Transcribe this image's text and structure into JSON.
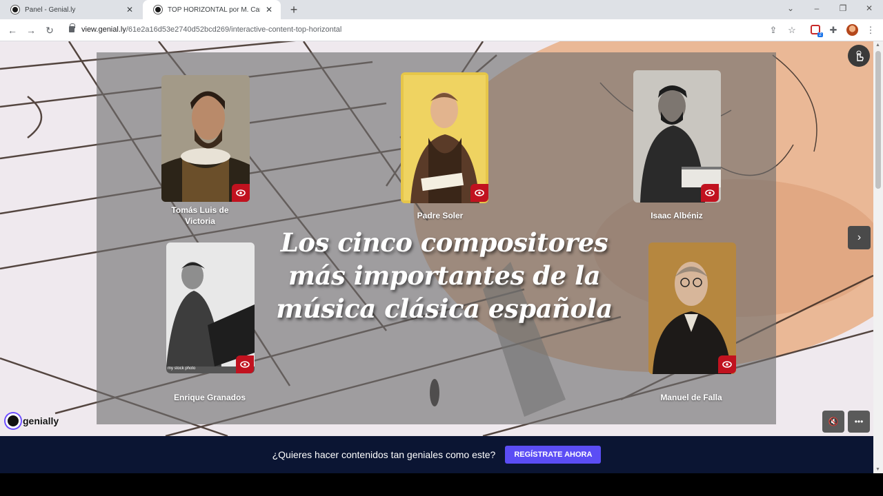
{
  "browser": {
    "tabs": [
      {
        "title": "Panel - Genial.ly",
        "active": false
      },
      {
        "title": "TOP HORIZONTAL por M. Carme",
        "active": true
      }
    ],
    "url_domain": "view.genial.ly",
    "url_path": "/61e2a16d53e2740d52bcd269/interactive-content-top-horizontal",
    "extension_badge": "2"
  },
  "presentation": {
    "headline": "Los cinco compositores más importantes  de la música clásica española",
    "composers": [
      {
        "name_line1": "Tomás Luis de",
        "name_line2": "Victoria"
      },
      {
        "name_line1": "Padre Soler",
        "name_line2": ""
      },
      {
        "name_line1": "Isaac Albéniz",
        "name_line2": ""
      },
      {
        "name_line1": "Enrique Granados",
        "name_line2": "",
        "photo_caption": "my stock photo"
      },
      {
        "name_line1": "Manuel de Falla",
        "name_line2": ""
      }
    ],
    "brand": "genially",
    "accent_color": "#c1121f"
  },
  "cta": {
    "text": "¿Quieres hacer contenidos tan geniales como este?",
    "button": "REGÍSTRATE AHORA"
  }
}
